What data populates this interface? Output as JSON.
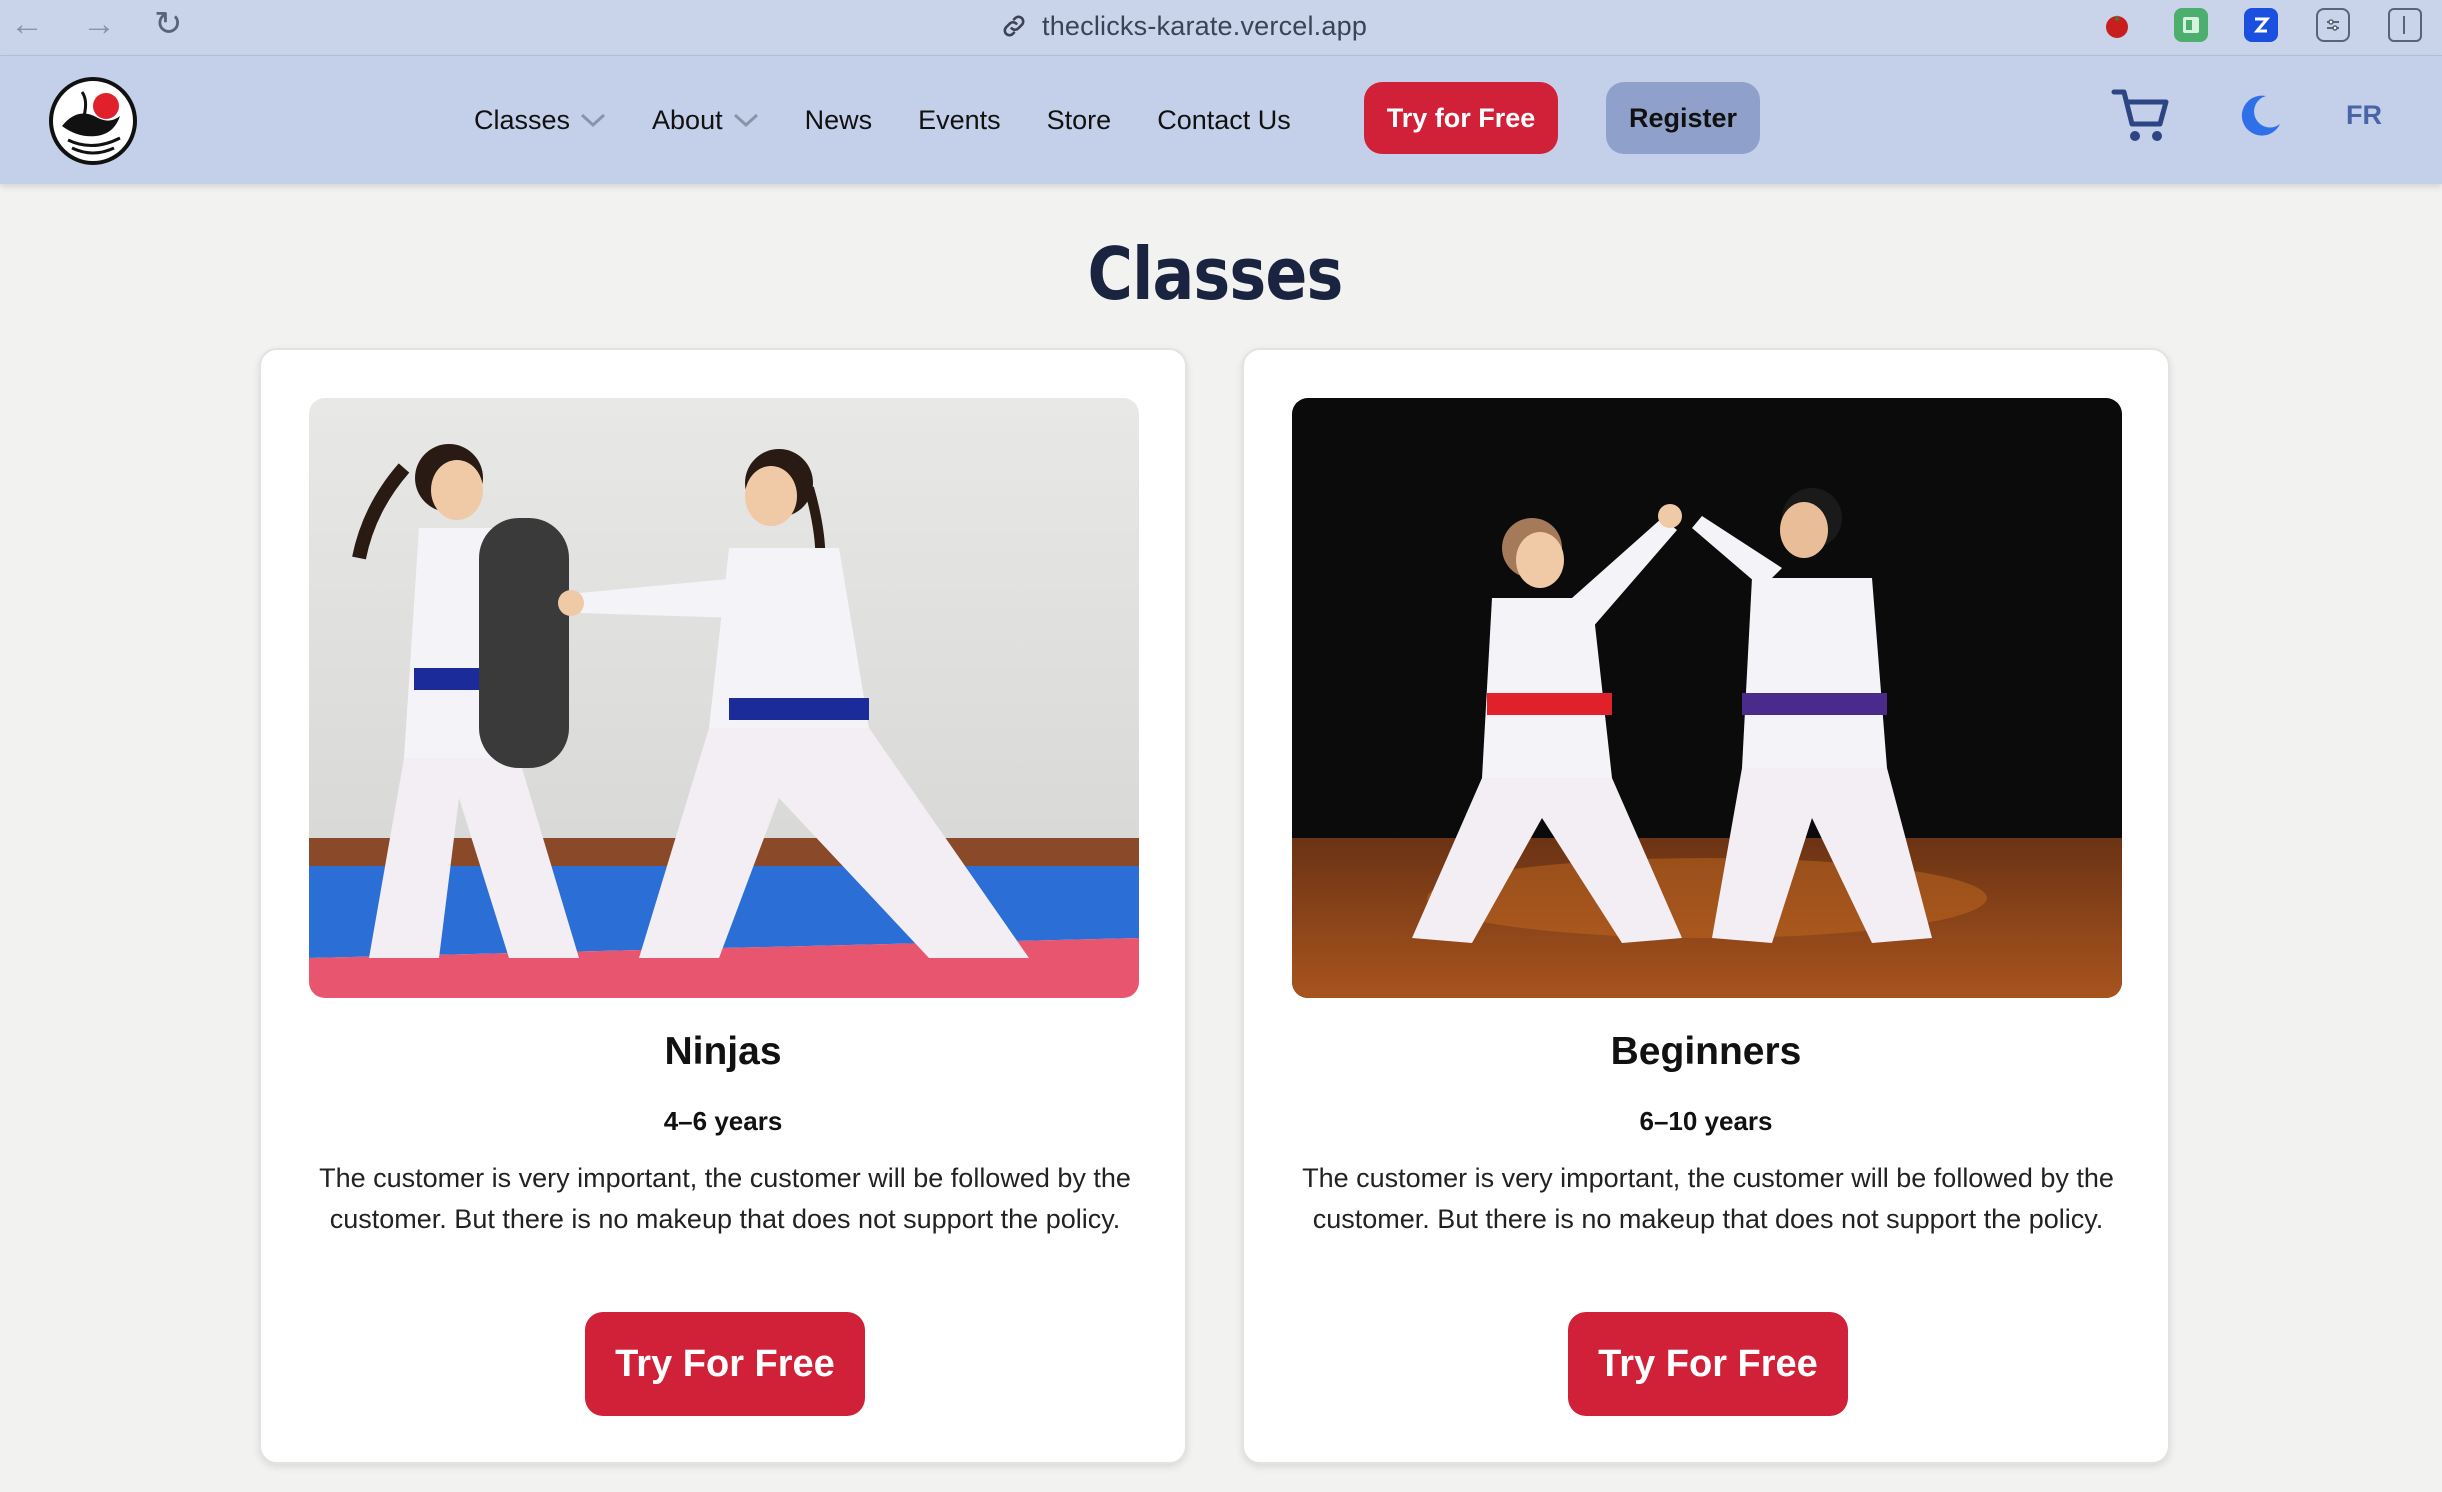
{
  "browser": {
    "url": "theclicks-karate.vercel.app",
    "back_icon": "arrow-left-icon",
    "forward_icon": "arrow-right-icon",
    "reload_icon": "reload-icon"
  },
  "header": {
    "nav": [
      {
        "label": "Classes",
        "has_dropdown": true
      },
      {
        "label": "About",
        "has_dropdown": true
      },
      {
        "label": "News",
        "has_dropdown": false
      },
      {
        "label": "Events",
        "has_dropdown": false
      },
      {
        "label": "Store",
        "has_dropdown": false
      },
      {
        "label": "Contact Us",
        "has_dropdown": false
      }
    ],
    "try_button": "Try for Free",
    "register_button": "Register",
    "language": "FR"
  },
  "main": {
    "title": "Classes",
    "cards": [
      {
        "name": "Ninjas",
        "age": "4–6 years",
        "description": "The customer is very important, the customer will be followed by the customer. But there is no makeup that does not support the policy.",
        "button": "Try For Free"
      },
      {
        "name": "Beginners",
        "age": "6–10 years",
        "description": "The customer is very important, the customer will be followed by the customer. But there is no makeup that does not support the policy.",
        "button": "Try For Free"
      }
    ]
  },
  "colors": {
    "accent_red": "#d02138",
    "header_bg": "#c4cfea",
    "register_bg": "#8fa1cb",
    "title_navy": "#1a2440",
    "moon_blue": "#2f6fe8"
  }
}
